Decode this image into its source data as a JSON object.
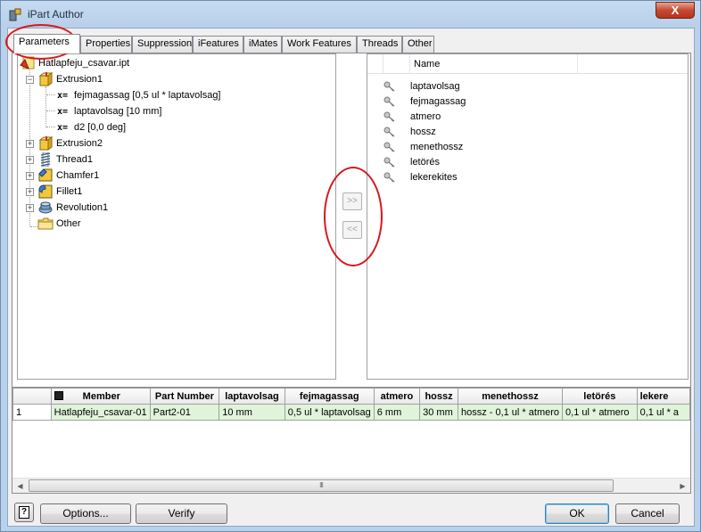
{
  "window": {
    "title": "iPart Author",
    "close_label": "X",
    "app_icon": "ipart-icon"
  },
  "tabs": [
    {
      "label": "Parameters",
      "active": true
    },
    {
      "label": "Properties"
    },
    {
      "label": "Suppression"
    },
    {
      "label": "iFeatures"
    },
    {
      "label": "iMates"
    },
    {
      "label": "Work Features"
    },
    {
      "label": "Threads"
    },
    {
      "label": "Other"
    }
  ],
  "tree": {
    "root": "Hatlapfeju_csavar.ipt",
    "extrusion1": "Extrusion1",
    "params": [
      {
        "prefix": "x=",
        "label": "fejmagassag [0,5 ul * laptavolsag]"
      },
      {
        "prefix": "x=",
        "label": "laptavolsag [10 mm]"
      },
      {
        "prefix": "x=",
        "label": "d2 [0,0 deg]"
      }
    ],
    "features": [
      "Extrusion2",
      "Thread1",
      "Chamfer1",
      "Fillet1",
      "Revolution1",
      "Other"
    ]
  },
  "transfer": {
    "add_label": ">>",
    "remove_label": "<<"
  },
  "selected_list": {
    "header": "Name",
    "items": [
      "laptavolsag",
      "fejmagassag",
      "atmero",
      "hossz",
      "menethossz",
      "letörés",
      "lekerekites"
    ]
  },
  "grid": {
    "columns": [
      "Member",
      "Part Number",
      "laptavolsag",
      "fejmagassag",
      "atmero",
      "hossz",
      "menethossz",
      "letörés",
      "lekere"
    ],
    "rows": [
      {
        "num": "1",
        "cells": [
          "Hatlapfeju_csavar-01",
          "Part2-01",
          "10 mm",
          "0,5 ul * laptavolsag",
          "6 mm",
          "30 mm",
          "hossz - 0,1 ul * atmero",
          "0,1 ul * atmero",
          "0,1 ul * a"
        ]
      }
    ],
    "scroll_grip": "III"
  },
  "buttons": {
    "help": "?",
    "options": "Options...",
    "verify": "Verify",
    "ok": "OK",
    "cancel": "Cancel"
  },
  "colors": {
    "callout": "#d8171d",
    "row_highlight": "#dff5d9"
  }
}
